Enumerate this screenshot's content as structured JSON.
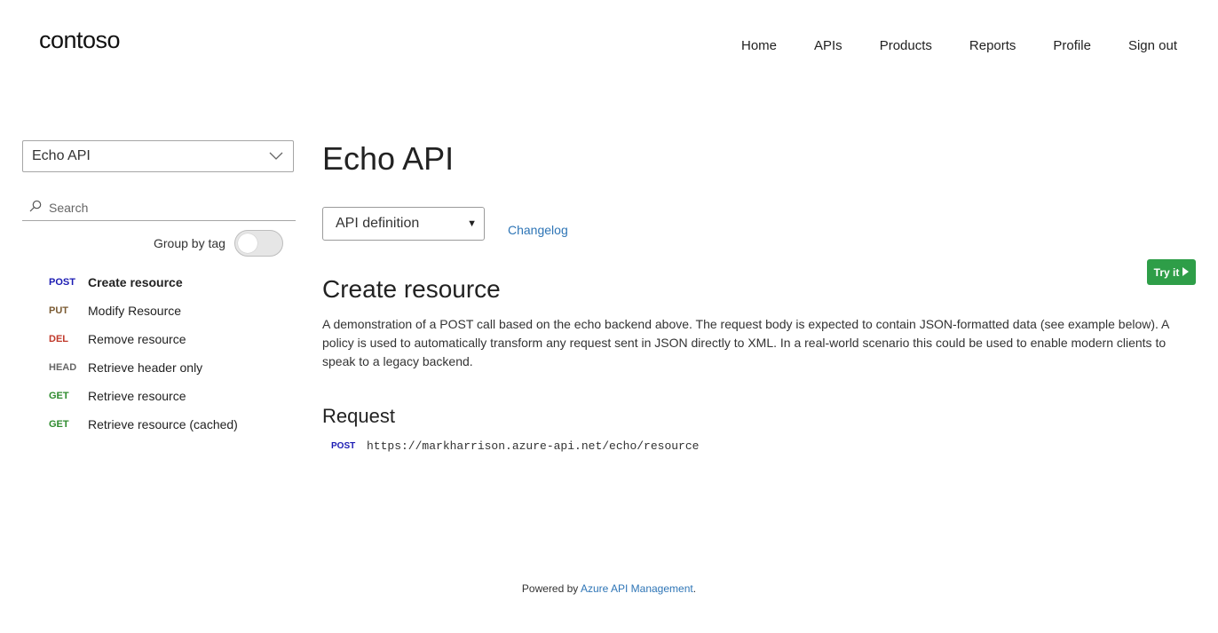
{
  "header": {
    "logo": "contoso",
    "nav": [
      "Home",
      "APIs",
      "Products",
      "Reports",
      "Profile",
      "Sign out"
    ]
  },
  "sidebar": {
    "api_selector": {
      "value": "Echo API",
      "icon": "chevron-down-icon"
    },
    "search": {
      "placeholder": "Search",
      "icon": "search-icon"
    },
    "group_by_tag": {
      "label": "Group by tag",
      "enabled": false
    },
    "operations": [
      {
        "method": "POST",
        "name": "Create resource",
        "color": "#1b1bb3",
        "active": true
      },
      {
        "method": "PUT",
        "name": "Modify Resource",
        "color": "#7a5a32",
        "active": false
      },
      {
        "method": "DEL",
        "name": "Remove resource",
        "color": "#c0392b",
        "active": false
      },
      {
        "method": "HEAD",
        "name": "Retrieve header only",
        "color": "#666666",
        "active": false
      },
      {
        "method": "GET",
        "name": "Retrieve resource",
        "color": "#2e8b2e",
        "active": false
      },
      {
        "method": "GET",
        "name": "Retrieve resource (cached)",
        "color": "#2e8b2e",
        "active": false
      }
    ]
  },
  "main": {
    "title": "Echo API",
    "definition_select": "API definition",
    "changelog": "Changelog",
    "try_it": "Try it",
    "operation_title": "Create resource",
    "description": "A demonstration of a POST call based on the echo backend above. The request body is expected to contain JSON-formatted data (see example below). A policy is used to automatically transform any request sent in JSON directly to XML. In a real-world scenario this could be used to enable modern clients to speak to a legacy backend.",
    "request_heading": "Request",
    "request": {
      "method": "POST",
      "url": "https://markharrison.azure-api.net/echo/resource"
    }
  },
  "footer": {
    "prefix": "Powered by ",
    "link": "Azure API Management",
    "suffix": "."
  }
}
